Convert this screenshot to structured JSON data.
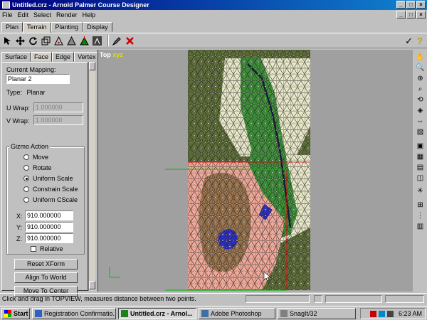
{
  "window": {
    "title": "Untitled.crz - Arnold Palmer Course Designer",
    "min": "_",
    "max": "□",
    "close": "×"
  },
  "menu": [
    "File",
    "Edit",
    "Select",
    "Render",
    "Help"
  ],
  "mode_tabs": [
    "Plan",
    "Terrain",
    "Planting",
    "Display"
  ],
  "active_mode_tab": "Terrain",
  "panel": {
    "tabs": [
      "Surface",
      "Face",
      "Edge",
      "Vertex"
    ],
    "active_tab": "Face",
    "current_mapping_label": "Current Mapping:",
    "current_mapping_value": "Planar 2",
    "type_label": "Type:",
    "type_value": "Planar",
    "uwrap_label": "U Wrap:",
    "uwrap_value": "1.000000",
    "vwrap_label": "V Wrap:",
    "vwrap_value": "1.000000",
    "gizmo_label": "Gizmo Action",
    "gizmo_options": [
      "Move",
      "Rotate",
      "Uniform Scale",
      "Constrain Scale",
      "Uniform CScale"
    ],
    "gizmo_selected": "Uniform Scale",
    "x_label": "X:",
    "x_value": "910.000000",
    "y_label": "Y:",
    "y_value": "910.000000",
    "z_label": "Z:",
    "z_value": "910.000000",
    "relative_label": "Relative",
    "reset_button": "Reset XForm",
    "align_button": "Align To World",
    "move_center_button": "Move To Center"
  },
  "viewport": {
    "view_label": "Top",
    "axis_label": "xyz",
    "colors": {
      "background": "#a0a0a0",
      "rough": "#5f6f3a",
      "fairway": "#3f8f3a",
      "sand": "#e8e8c8",
      "selection": "#f0a898",
      "water": "#3030c0"
    }
  },
  "status": {
    "message": "Click and drag in TOPVIEW, measures distance between two points."
  },
  "taskbar": {
    "start": "Start",
    "tasks": [
      "Registration Confirmatio...",
      "Untitled.crz - Arnol...",
      "Adobe Photoshop",
      "SnagIt/32"
    ],
    "active_task": "Untitled.crz - Arnol...",
    "clock": "6:23 AM"
  },
  "toolbar": {
    "confirm_icon": "✓",
    "help_icon": "?"
  }
}
